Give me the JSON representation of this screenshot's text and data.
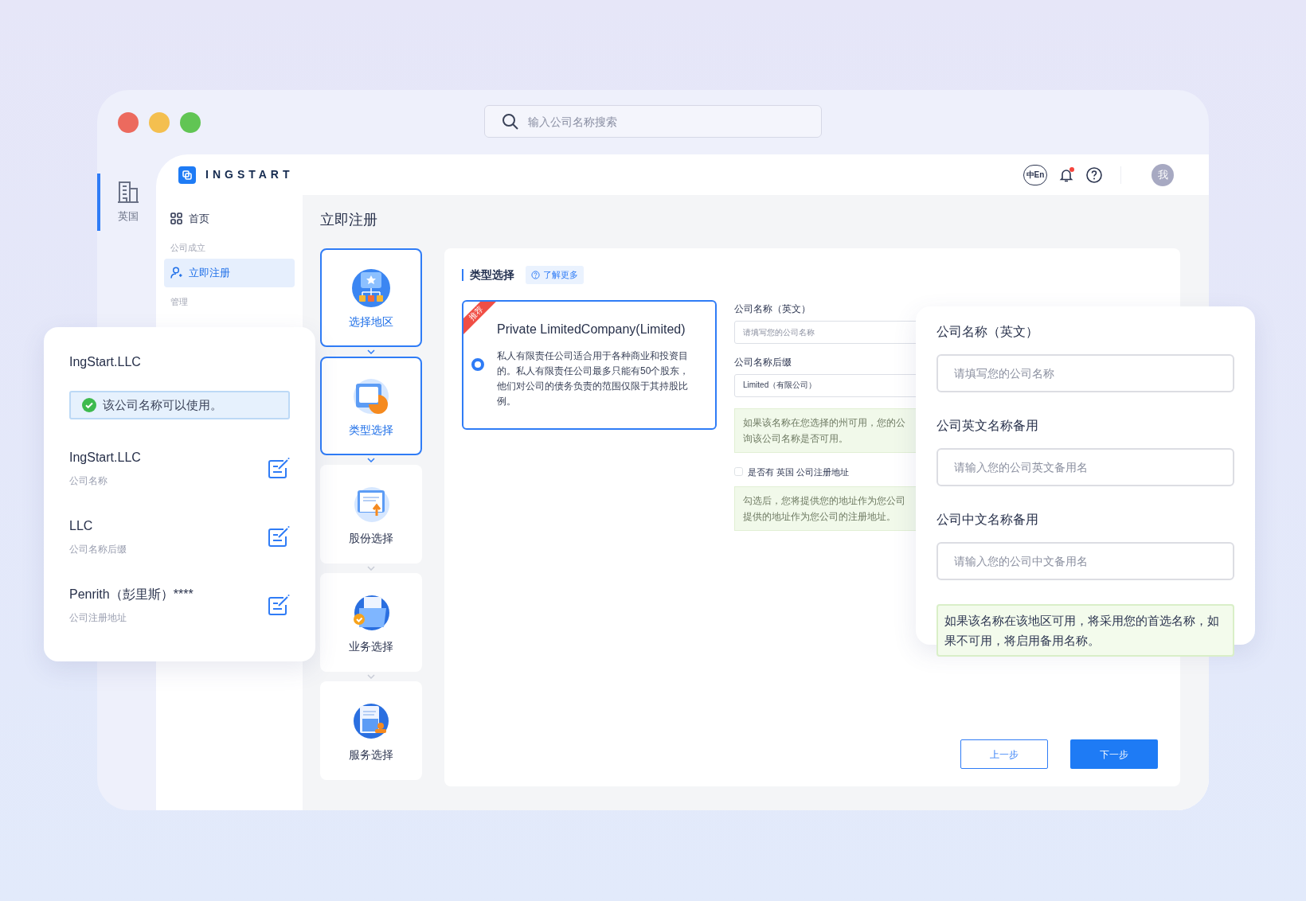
{
  "search": {
    "placeholder": "输入公司名称搜索"
  },
  "rail": {
    "items": [
      {
        "label": "英国",
        "selected": true
      }
    ]
  },
  "header": {
    "logo": "INGSTART",
    "language_button": "中En",
    "has_unread_notifications": true,
    "avatar": "我"
  },
  "sidebar": {
    "items": [
      {
        "kind": "link",
        "label": "首页",
        "selected": false
      },
      {
        "kind": "group",
        "label": "公司成立"
      },
      {
        "kind": "link",
        "label": "立即注册",
        "selected": true
      },
      {
        "kind": "group",
        "label": "管理"
      }
    ]
  },
  "page_title": "立即注册",
  "steps": [
    {
      "label": "选择地区",
      "active": true
    },
    {
      "label": "类型选择",
      "active": true
    },
    {
      "label": "股份选择",
      "active": false
    },
    {
      "label": "业务选择",
      "active": false
    },
    {
      "label": "服务选择",
      "active": false
    }
  ],
  "section": {
    "title": "类型选择",
    "help_link": "了解更多"
  },
  "company_types": [
    {
      "ribbon": "推荐",
      "title": "Private LimitedCompany(Limited)",
      "description": "私人有限责任公司适合用于各种商业和投资目的。私人有限责任公司最多只能有50个股东，他们对公司的债务负责的范围仅限于其持股比例。",
      "selected": true
    }
  ],
  "form": {
    "fields": [
      {
        "label": "公司名称（英文）",
        "placeholder": "请填写您的公司名称"
      },
      {
        "label": "公司名称后缀",
        "value": "Limited（有限公司）"
      }
    ],
    "name_note": [
      "如果该名称在您选择的州可用，您的公",
      "询该公司名称是否可用。"
    ],
    "address_checkbox": {
      "label": "是否有 英国 公司注册地址",
      "checked": false
    },
    "address_note": [
      "勾选后，您将提供您的地址作为您公司",
      "提供的地址作为您公司的注册地址。"
    ]
  },
  "buttons": [
    {
      "label": "上一步",
      "kind": "secondary"
    },
    {
      "label": "下一步",
      "kind": "primary"
    }
  ],
  "name_check_card": {
    "name": "IngStart.LLC",
    "status": "该公司名称可以使用。",
    "entries": [
      {
        "value": "IngStart.LLC",
        "label": "公司名称"
      },
      {
        "value": "LLC",
        "label": "公司名称后缀"
      },
      {
        "value": "Penrith（彭里斯）****",
        "label": "公司注册地址"
      }
    ]
  },
  "alternate_names_card": {
    "fields": [
      {
        "label": "公司名称（英文）",
        "placeholder": "请填写您的公司名称"
      },
      {
        "label": "公司英文名称备用",
        "placeholder": "请输入您的公司英文备用名"
      },
      {
        "label": "公司中文名称备用",
        "placeholder": "请输入您的公司中文备用名"
      }
    ],
    "note": "如果该名称在该地区可用，将采用您的首选名称，如果不可用，将启用备用名称。"
  }
}
